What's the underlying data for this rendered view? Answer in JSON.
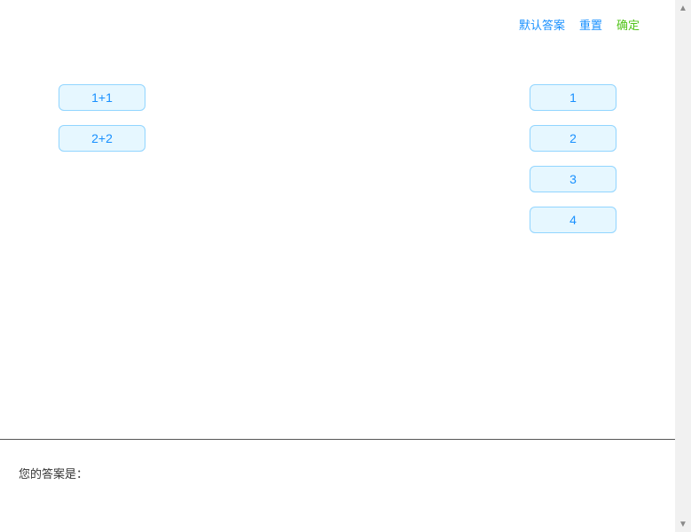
{
  "toolbar": {
    "default_answer_label": "默认答案",
    "reset_label": "重置",
    "confirm_label": "确定"
  },
  "left_items": [
    "1+1",
    "2+2"
  ],
  "right_items": [
    "1",
    "2",
    "3",
    "4"
  ],
  "answer_label": "您的答案是："
}
